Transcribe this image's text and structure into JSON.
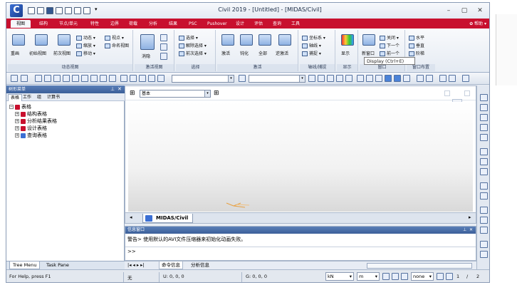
{
  "window": {
    "title": "Civil 2019 - [Untitled] - [MIDAS/Civil]",
    "logo": "C",
    "controls": [
      "–",
      "▢",
      "✕"
    ]
  },
  "ribbon_tabs": [
    "视图",
    "结构",
    "节点/单元",
    "特性",
    "边界",
    "荷载",
    "分析",
    "结果",
    "PSC",
    "Pushover",
    "设计",
    "评估",
    "查询",
    "工具"
  ],
  "help": {
    "label": "帮助",
    "icon": "gear-icon"
  },
  "ribbon": {
    "groups": [
      {
        "label": "动态视图",
        "items": [
          "重画",
          "初始视图",
          "前次视图",
          "动态",
          "缩放",
          "移动",
          "视点",
          "命名视图"
        ]
      },
      {
        "label": "激活视图",
        "items": [
          "消隐"
        ]
      },
      {
        "label": "选择",
        "items": [
          "选择",
          "解除选择",
          "前次选择"
        ]
      },
      {
        "label": "激活",
        "items": [
          "激活",
          "钝化",
          "全部",
          "逆激活"
        ]
      },
      {
        "label": "轴线/捕捉",
        "items": [
          "坐标系",
          "轴线",
          "捕捉"
        ]
      },
      {
        "label": "显示",
        "items": [
          "显示"
        ]
      },
      {
        "label": "窗口",
        "items": [
          "新窗口",
          "关闭",
          "下一个",
          "前一个"
        ]
      },
      {
        "label": "窗口布置",
        "items": [
          "水平",
          "垂直",
          "阶梯"
        ]
      }
    ],
    "tooltip": "Display (Ctrl+E)"
  },
  "tree_panel": {
    "header": "树形菜单",
    "subtabs": [
      "表格",
      "工作",
      "组",
      "计算书"
    ],
    "nodes": [
      "表格",
      "结构表格",
      "分析结果表格",
      "设计表格",
      "查询表格"
    ],
    "bottom_tabs": [
      "Tree Menu",
      "Task Pane"
    ]
  },
  "view": {
    "combo_left": "基本",
    "doc_tab": "MIDAS/Civil"
  },
  "message_window": {
    "header": "信息窗口",
    "text": "警告> 使用默认的AVI文件压缩器来初始化动画失败。",
    "prompt": ">>",
    "tabs": [
      "命令信息",
      "分析信息"
    ]
  },
  "status": {
    "help": "For Help, press F1",
    "node_field": "无",
    "u_coord": "U: 0, 0, 0",
    "g_coord": "G: 0, 0, 0",
    "unit": "kN",
    "unit2": "m",
    "mode": "none",
    "page": "1",
    "page_sep": "/",
    "page_total": "2"
  }
}
